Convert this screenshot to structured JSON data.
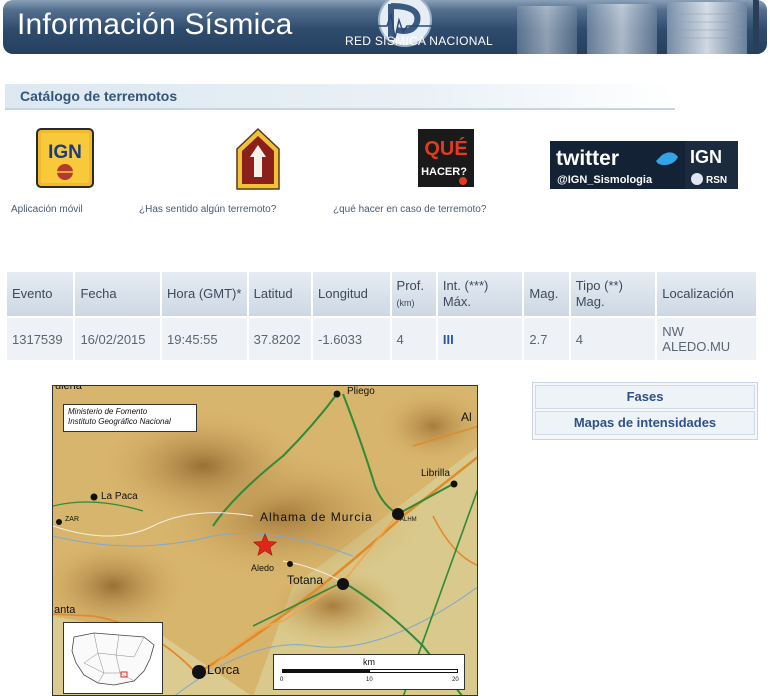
{
  "header": {
    "title": "Información Sísmica",
    "logo_text": "RED SÍSMICA NACIONAL"
  },
  "section": {
    "title": "Catálogo de terremotos"
  },
  "links": {
    "app": {
      "label": "Aplicación móvil",
      "badge": "IGN"
    },
    "felt": {
      "label": "¿Has sentido algún terremoto?"
    },
    "what": {
      "label": "¿qué hacer en caso de terremoto?",
      "badge_top": "QUÉ",
      "badge_bottom": "HACER?"
    },
    "twitter": {
      "word": "twitter",
      "ign": "IGN",
      "handle": "@IGN_Sismologia",
      "rsn": "RSN"
    }
  },
  "table": {
    "headers": {
      "evento": "Evento",
      "fecha": "Fecha",
      "hora": "Hora (GMT)*",
      "latitud": "Latitud",
      "longitud": "Longitud",
      "prof": "Prof.",
      "prof_unit": "(km)",
      "int": "Int. (***) Máx.",
      "mag": "Mag.",
      "tipo": "Tipo (**) Mag.",
      "loc": "Localización"
    },
    "row": {
      "evento": "1317539",
      "fecha": "16/02/2015",
      "hora": "19:45:55",
      "latitud": "37.8202",
      "longitud": "-1.6033",
      "prof": "4",
      "int": "III",
      "mag": "2.7",
      "tipo": "4",
      "loc": "NW ALEDO.MU"
    }
  },
  "side": {
    "fases": "Fases",
    "mapas": "Mapas de intensidades"
  },
  "map": {
    "credit_1": "Ministerio de Fomento",
    "credit_2": "Instituto Geográfico Nacional",
    "places": {
      "pliego": "Pliego",
      "al": "Al",
      "librilla": "Librilla",
      "la_paca": "La Paca",
      "zarcilla": "ZAR",
      "alhama": "Alhama de Murcia",
      "alhm": "ALHM",
      "aledo": "Aledo",
      "totana": "Totana",
      "anta": "anta",
      "lorca": "Lorca",
      "top_left": "ulena"
    },
    "scale": {
      "unit": "km",
      "t0": "0",
      "t1": "10",
      "t2": "20"
    },
    "colors": {
      "terrain": "#d6b46c",
      "epicenter": "#e0261b",
      "road_green": "#2f8a3a",
      "road_orange": "#e08a2a"
    }
  }
}
